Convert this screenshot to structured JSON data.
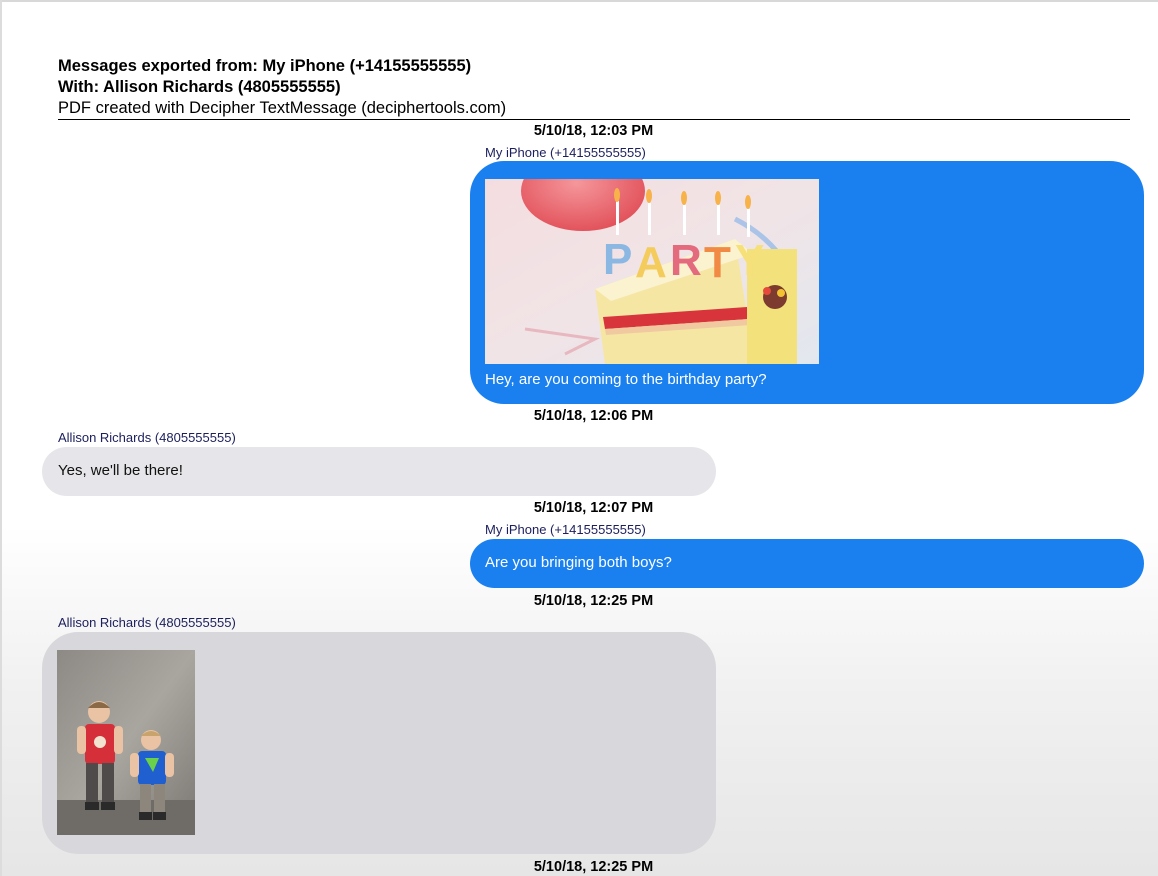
{
  "header": {
    "exported_from": "Messages exported from: My iPhone (+14155555555)",
    "with": "With: Allison Richards (4805555555)",
    "created_with": "PDF created with Decipher TextMessage (deciphertools.com)"
  },
  "messages": [
    {
      "timestamp": "5/10/18, 12:03 PM",
      "sender": "My iPhone (+14155555555)",
      "direction": "outgoing",
      "attachment": "party-cake-photo",
      "text": "Hey, are you coming to the birthday party?"
    },
    {
      "timestamp": "5/10/18, 12:06 PM",
      "sender": "Allison Richards (4805555555)",
      "direction": "incoming",
      "text": "Yes, we'll be there!"
    },
    {
      "timestamp": "5/10/18, 12:07 PM",
      "sender": "My iPhone (+14155555555)",
      "direction": "outgoing",
      "text": "Are you bringing both boys?"
    },
    {
      "timestamp": "5/10/18, 12:25 PM",
      "sender": "Allison Richards (4805555555)",
      "direction": "incoming",
      "attachment": "two-boys-photo"
    },
    {
      "timestamp": "5/10/18, 12:25 PM"
    }
  ],
  "colors": {
    "outgoing_bubble": "#1a80f0",
    "incoming_bubble": "#e6e6ea",
    "sender_label": "#1b1f5c"
  }
}
